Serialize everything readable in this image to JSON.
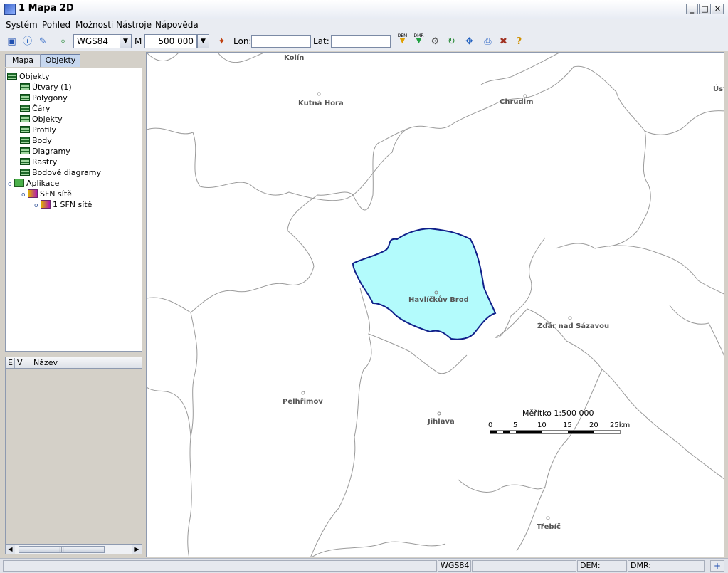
{
  "window": {
    "title": "1 Mapa 2D"
  },
  "menu": [
    "Systém",
    "Pohled",
    "Možnosti",
    "Nástroje",
    "Nápověda"
  ],
  "toolbar": {
    "projection": "WGS84",
    "scale_prefix": "M",
    "scale_value": "500 000",
    "lon_label": "Lon:",
    "lat_label": "Lat:",
    "lon_value": "",
    "lat_value": "",
    "dem_label": "DEM",
    "dmr_label": "DMR"
  },
  "left_panel": {
    "tabs": [
      "Mapa",
      "Objekty"
    ],
    "active_tab": "Objekty",
    "tree": {
      "root": "Objekty",
      "layers": [
        "Útvary (1)",
        "Polygony",
        "Čáry",
        "Objekty",
        "Profily",
        "Body",
        "Diagramy",
        "Rastry",
        "Bodové diagramy"
      ],
      "app_node": "Aplikace",
      "sfn_node": "SFN sítě",
      "sfn_child": "1 SFN sítě"
    },
    "columns": [
      "E",
      "V",
      "Název"
    ]
  },
  "map": {
    "cities": [
      "Kolín",
      "Kutná Hora",
      "Chrudim",
      "Úst",
      "Havlíčkův Brod",
      "Žďár nad Sázavou",
      "Pelhřimov",
      "Jihlava",
      "Třebíč"
    ],
    "highlight_fill": "#b3fbfc",
    "highlight_stroke": "#10208a",
    "scale_bar": {
      "title": "Měřítko 1:500 000",
      "ticks": [
        "0",
        "5",
        "10",
        "15",
        "20",
        "25km"
      ]
    }
  },
  "status": {
    "projection": "WGS84",
    "dem_label": "DEM:",
    "dmr_label": "DMR:"
  }
}
